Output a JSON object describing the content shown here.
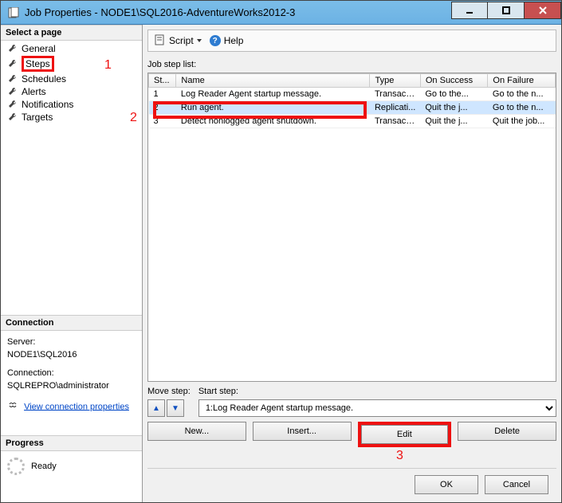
{
  "window": {
    "title": "Job Properties - NODE1\\SQL2016-AdventureWorks2012-3"
  },
  "sidebar": {
    "heading": "Select a page",
    "items": [
      {
        "label": "General"
      },
      {
        "label": "Steps"
      },
      {
        "label": "Schedules"
      },
      {
        "label": "Alerts"
      },
      {
        "label": "Notifications"
      },
      {
        "label": "Targets"
      }
    ]
  },
  "callouts": {
    "one": "1",
    "two": "2",
    "three": "3"
  },
  "connection": {
    "heading": "Connection",
    "server_label": "Server:",
    "server_value": "NODE1\\SQL2016",
    "conn_label": "Connection:",
    "conn_value": "SQLREPRO\\administrator",
    "link": "View connection properties"
  },
  "progress": {
    "heading": "Progress",
    "status": "Ready"
  },
  "toolbar": {
    "script": "Script",
    "help": "Help"
  },
  "list_label": "Job step list:",
  "columns": {
    "st": "St...",
    "name": "Name",
    "type": "Type",
    "success": "On Success",
    "failure": "On Failure"
  },
  "rows": [
    {
      "id": "1",
      "name": "Log Reader Agent startup message.",
      "type": "Transact-...",
      "success": "Go to the...",
      "failure": "Go to the n..."
    },
    {
      "id": "2",
      "name": "Run agent.",
      "type": "Replicati...",
      "success": "Quit the j...",
      "failure": "Go to the n..."
    },
    {
      "id": "3",
      "name": "Detect nonlogged agent shutdown.",
      "type": "Transact-...",
      "success": "Quit the j...",
      "failure": "Quit the job..."
    }
  ],
  "move_step_label": "Move step:",
  "start_step_label": "Start step:",
  "start_step_value": "1:Log Reader Agent startup message.",
  "buttons": {
    "new": "New...",
    "insert": "Insert...",
    "edit": "Edit",
    "delete": "Delete",
    "ok": "OK",
    "cancel": "Cancel"
  }
}
